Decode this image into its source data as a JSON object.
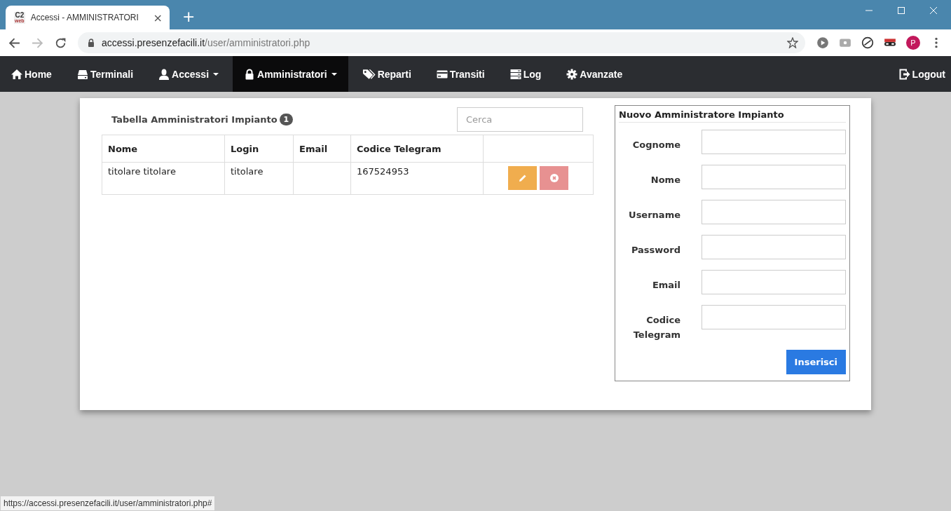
{
  "browser": {
    "tab": {
      "favicon": [
        "C2",
        "web"
      ],
      "title": "Accessi - AMMINISTRATORI",
      "close": "×"
    },
    "new_tab": "+",
    "address": {
      "host": "accessi.presenzefacili.it",
      "path": "/user/amministratori.php"
    },
    "profile": "P"
  },
  "navbar": {
    "items": [
      {
        "kind": "home",
        "label": "Home",
        "caret": false,
        "selected": false
      },
      {
        "kind": "drive",
        "label": "Terminali",
        "caret": false,
        "selected": false
      },
      {
        "kind": "user",
        "label": "Accessi",
        "caret": true,
        "selected": false
      },
      {
        "kind": "lock",
        "label": "Amministratori",
        "caret": true,
        "selected": true
      },
      {
        "kind": "tag",
        "label": "Reparti",
        "caret": false,
        "selected": false
      },
      {
        "kind": "card",
        "label": "Transiti",
        "caret": false,
        "selected": false
      },
      {
        "kind": "server",
        "label": "Log",
        "caret": false,
        "selected": false
      },
      {
        "kind": "gear",
        "label": "Avanzate",
        "caret": false,
        "selected": false
      }
    ],
    "logout": {
      "kind": "logout",
      "label": "Logout"
    }
  },
  "table": {
    "title": "Tabella Amministratori Impianto",
    "count": "1",
    "search": {
      "placeholder": "Cerca"
    },
    "columns": [
      "Nome",
      "Login",
      "Email",
      "Codice Telegram"
    ],
    "rows": [
      {
        "cells": [
          "titolare titolare",
          "titolare",
          "",
          "167524953"
        ]
      }
    ]
  },
  "form": {
    "title": "Nuovo Amministratore Impianto",
    "fields": [
      {
        "label": "Cognome"
      },
      {
        "label": "Nome"
      },
      {
        "label": "Username"
      },
      {
        "label": "Password"
      },
      {
        "label": "Email"
      },
      {
        "label": "Codice Telegram"
      }
    ],
    "submit": "Inserisci"
  },
  "status_bar": "https://accessi.presenzefacili.it/user/amministratori.php#"
}
